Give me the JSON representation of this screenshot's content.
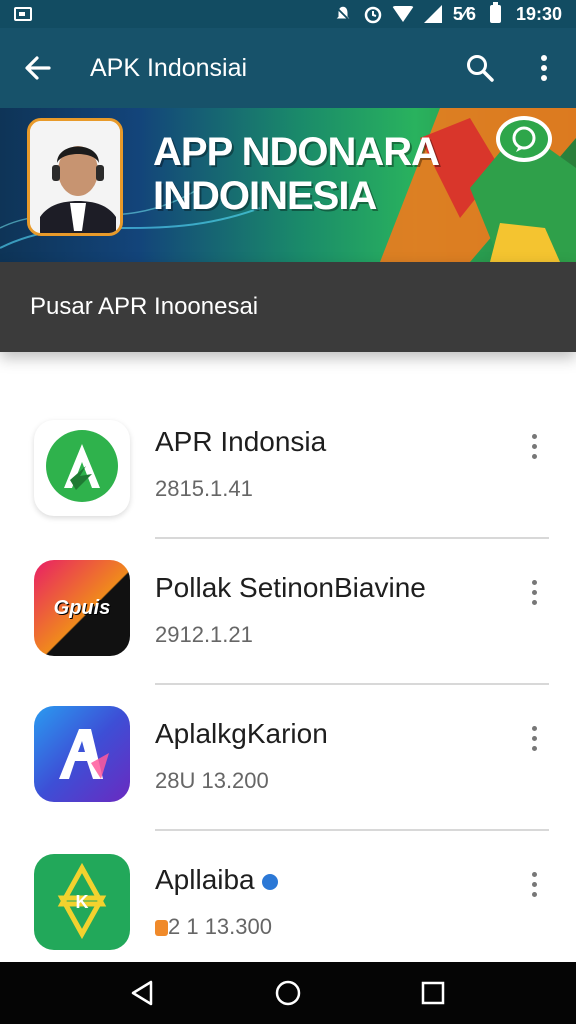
{
  "status_bar": {
    "battery_text": "5⁄6",
    "time": "19:30",
    "icons": [
      "sim-icon",
      "alarm-icon",
      "wifi-icon",
      "signal-icon",
      "battery-icon"
    ]
  },
  "app_bar": {
    "title": "APK Indonsiai",
    "icons": [
      "back-arrow-icon",
      "search-icon",
      "more-vert-icon"
    ]
  },
  "banner": {
    "line1": "APP NDONARA",
    "line2": "INDOINESIA",
    "accent": "#29b25e"
  },
  "section": {
    "title": "Pusar APR Inoonesai"
  },
  "apps": [
    {
      "name": "APR Indonsia",
      "meta": "2815.1.41",
      "icon_label": "A",
      "icon": "a-logo-icon"
    },
    {
      "name": "Pollak SetinonBiavine",
      "meta": "2912.1.21",
      "icon_label": "Gpuis",
      "icon": "gpuis-logo-icon"
    },
    {
      "name": "AplalkgKarion",
      "meta": "28U 13.200",
      "icon_label": "A",
      "icon": "a-gradient-logo-icon"
    },
    {
      "name": "Apllaiba",
      "meta": "2 1 13.300",
      "icon_label": "K",
      "icon": "star-logo-icon"
    }
  ],
  "nav_bar": {
    "icons": [
      "back-triangle-icon",
      "home-circle-icon",
      "recents-square-icon"
    ]
  },
  "colors": {
    "status_bar": "#124c62",
    "app_bar": "#17526a",
    "section_header": "#3b3b3b",
    "nav_bar": "#050505"
  }
}
